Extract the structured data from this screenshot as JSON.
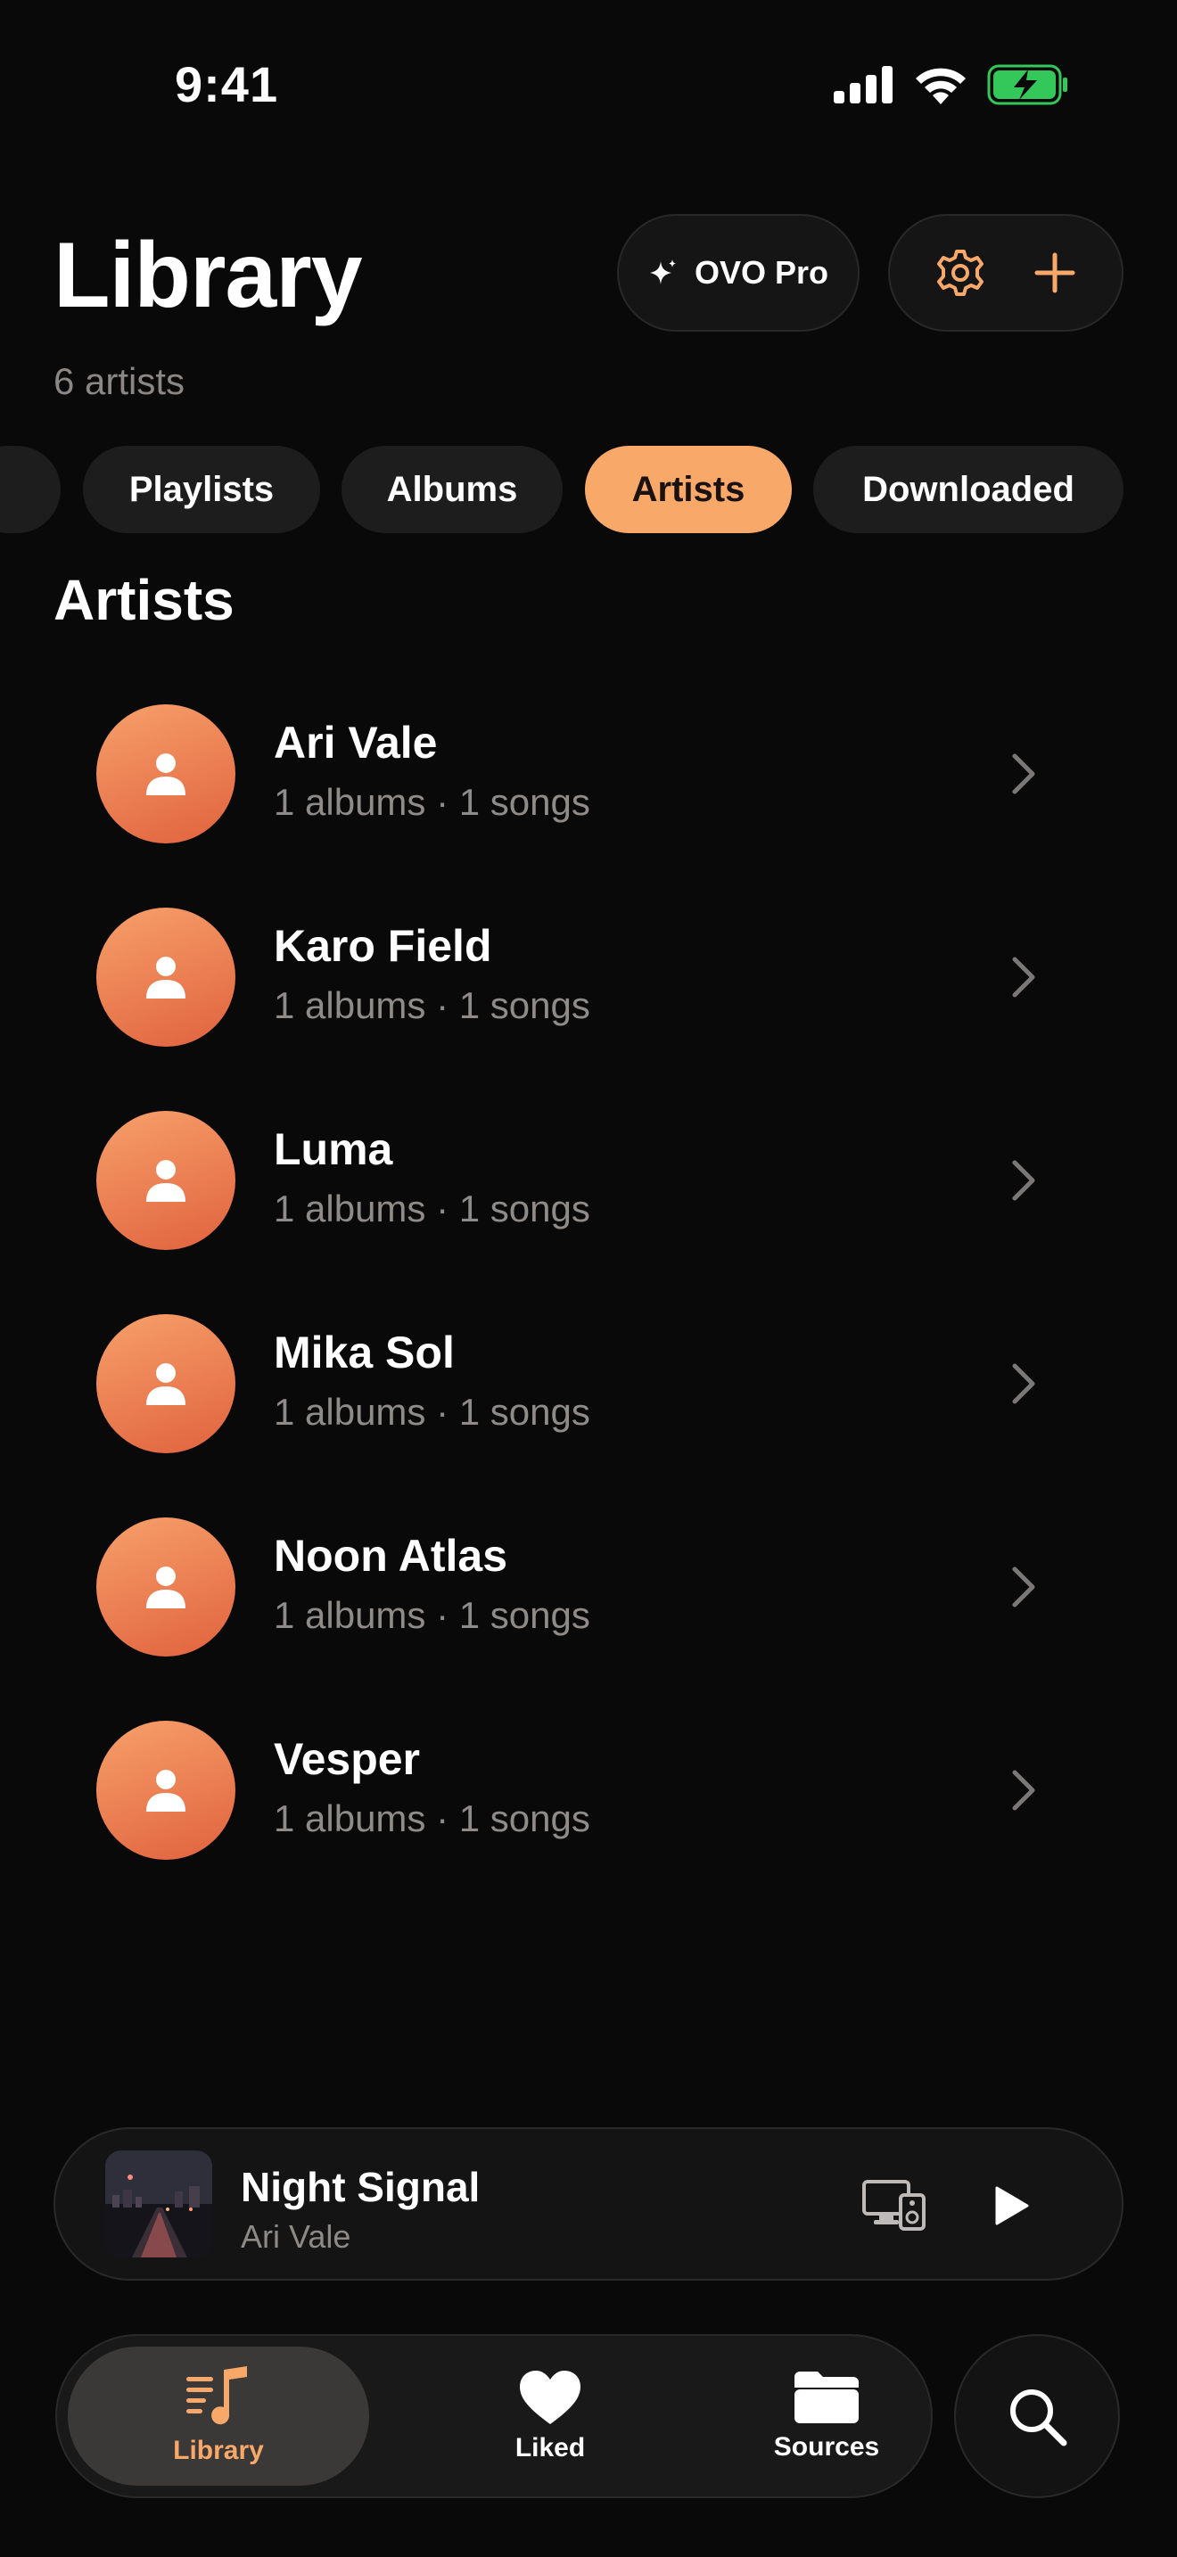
{
  "status_bar": {
    "time": "9:41"
  },
  "header": {
    "title": "Library",
    "subtitle": "6 artists",
    "pro_label": "OVO Pro"
  },
  "filters": {
    "chips": [
      {
        "label": "Playlists",
        "active": false
      },
      {
        "label": "Albums",
        "active": false
      },
      {
        "label": "Artists",
        "active": true
      },
      {
        "label": "Downloaded",
        "active": false
      }
    ]
  },
  "section_title": "Artists",
  "artists": [
    {
      "name": "Ari Vale",
      "meta": "1 albums · 1 songs"
    },
    {
      "name": "Karo Field",
      "meta": "1 albums · 1 songs"
    },
    {
      "name": "Luma",
      "meta": "1 albums · 1 songs"
    },
    {
      "name": "Mika Sol",
      "meta": "1 albums · 1 songs"
    },
    {
      "name": "Noon Atlas",
      "meta": "1 albums · 1 songs"
    },
    {
      "name": "Vesper",
      "meta": "1 albums · 1 songs"
    }
  ],
  "now_playing": {
    "title": "Night Signal",
    "artist": "Ari Vale"
  },
  "tabs": [
    {
      "label": "Library",
      "icon": "music-library-icon",
      "active": true
    },
    {
      "label": "Liked",
      "icon": "heart-icon",
      "active": false
    },
    {
      "label": "Sources",
      "icon": "folder-icon",
      "active": false
    }
  ],
  "colors": {
    "accent": "#f8a869",
    "background": "#0a0909",
    "battery": "#34c759"
  }
}
